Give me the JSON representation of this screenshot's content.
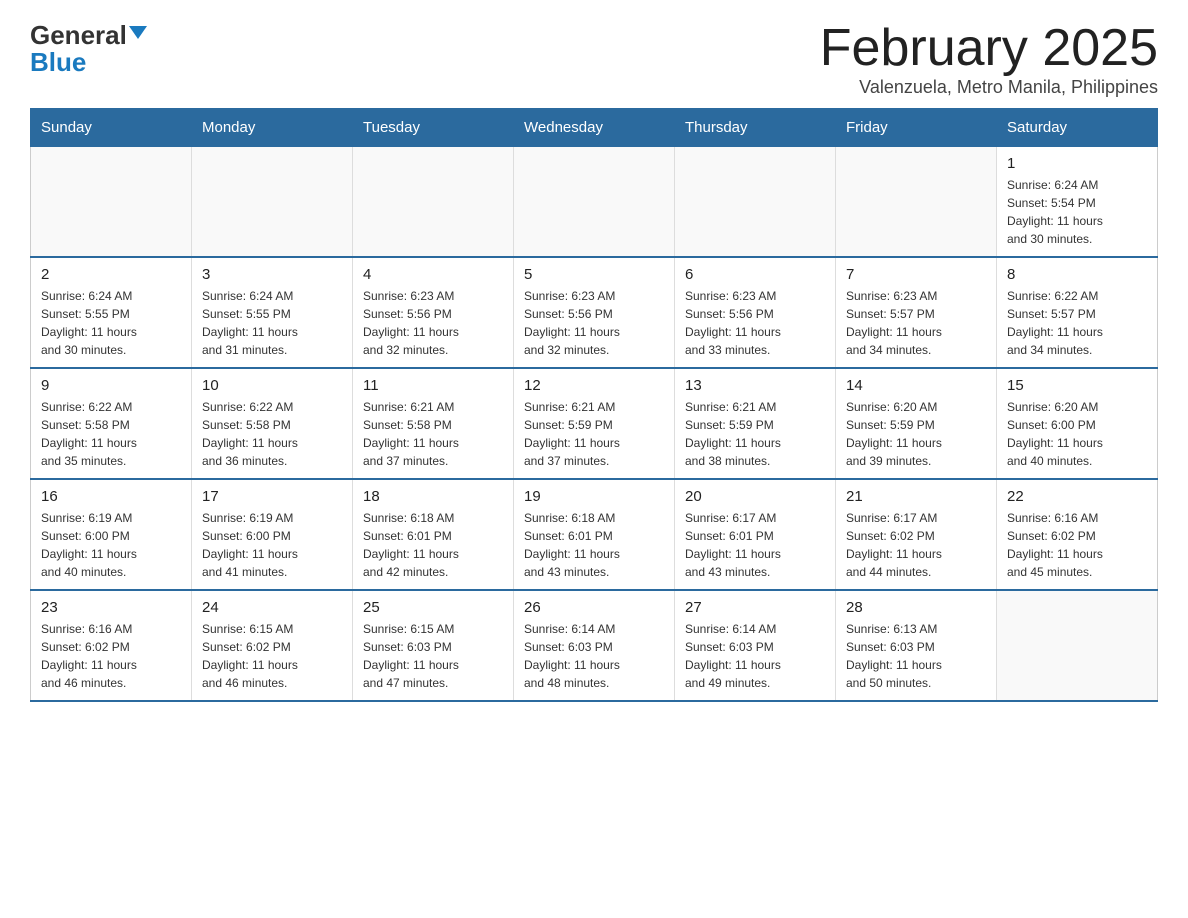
{
  "header": {
    "logo_general": "General",
    "logo_blue": "Blue",
    "title": "February 2025",
    "subtitle": "Valenzuela, Metro Manila, Philippines"
  },
  "days_of_week": [
    "Sunday",
    "Monday",
    "Tuesday",
    "Wednesday",
    "Thursday",
    "Friday",
    "Saturday"
  ],
  "weeks": [
    {
      "days": [
        {
          "number": "",
          "info": ""
        },
        {
          "number": "",
          "info": ""
        },
        {
          "number": "",
          "info": ""
        },
        {
          "number": "",
          "info": ""
        },
        {
          "number": "",
          "info": ""
        },
        {
          "number": "",
          "info": ""
        },
        {
          "number": "1",
          "info": "Sunrise: 6:24 AM\nSunset: 5:54 PM\nDaylight: 11 hours\nand 30 minutes."
        }
      ]
    },
    {
      "days": [
        {
          "number": "2",
          "info": "Sunrise: 6:24 AM\nSunset: 5:55 PM\nDaylight: 11 hours\nand 30 minutes."
        },
        {
          "number": "3",
          "info": "Sunrise: 6:24 AM\nSunset: 5:55 PM\nDaylight: 11 hours\nand 31 minutes."
        },
        {
          "number": "4",
          "info": "Sunrise: 6:23 AM\nSunset: 5:56 PM\nDaylight: 11 hours\nand 32 minutes."
        },
        {
          "number": "5",
          "info": "Sunrise: 6:23 AM\nSunset: 5:56 PM\nDaylight: 11 hours\nand 32 minutes."
        },
        {
          "number": "6",
          "info": "Sunrise: 6:23 AM\nSunset: 5:56 PM\nDaylight: 11 hours\nand 33 minutes."
        },
        {
          "number": "7",
          "info": "Sunrise: 6:23 AM\nSunset: 5:57 PM\nDaylight: 11 hours\nand 34 minutes."
        },
        {
          "number": "8",
          "info": "Sunrise: 6:22 AM\nSunset: 5:57 PM\nDaylight: 11 hours\nand 34 minutes."
        }
      ]
    },
    {
      "days": [
        {
          "number": "9",
          "info": "Sunrise: 6:22 AM\nSunset: 5:58 PM\nDaylight: 11 hours\nand 35 minutes."
        },
        {
          "number": "10",
          "info": "Sunrise: 6:22 AM\nSunset: 5:58 PM\nDaylight: 11 hours\nand 36 minutes."
        },
        {
          "number": "11",
          "info": "Sunrise: 6:21 AM\nSunset: 5:58 PM\nDaylight: 11 hours\nand 37 minutes."
        },
        {
          "number": "12",
          "info": "Sunrise: 6:21 AM\nSunset: 5:59 PM\nDaylight: 11 hours\nand 37 minutes."
        },
        {
          "number": "13",
          "info": "Sunrise: 6:21 AM\nSunset: 5:59 PM\nDaylight: 11 hours\nand 38 minutes."
        },
        {
          "number": "14",
          "info": "Sunrise: 6:20 AM\nSunset: 5:59 PM\nDaylight: 11 hours\nand 39 minutes."
        },
        {
          "number": "15",
          "info": "Sunrise: 6:20 AM\nSunset: 6:00 PM\nDaylight: 11 hours\nand 40 minutes."
        }
      ]
    },
    {
      "days": [
        {
          "number": "16",
          "info": "Sunrise: 6:19 AM\nSunset: 6:00 PM\nDaylight: 11 hours\nand 40 minutes."
        },
        {
          "number": "17",
          "info": "Sunrise: 6:19 AM\nSunset: 6:00 PM\nDaylight: 11 hours\nand 41 minutes."
        },
        {
          "number": "18",
          "info": "Sunrise: 6:18 AM\nSunset: 6:01 PM\nDaylight: 11 hours\nand 42 minutes."
        },
        {
          "number": "19",
          "info": "Sunrise: 6:18 AM\nSunset: 6:01 PM\nDaylight: 11 hours\nand 43 minutes."
        },
        {
          "number": "20",
          "info": "Sunrise: 6:17 AM\nSunset: 6:01 PM\nDaylight: 11 hours\nand 43 minutes."
        },
        {
          "number": "21",
          "info": "Sunrise: 6:17 AM\nSunset: 6:02 PM\nDaylight: 11 hours\nand 44 minutes."
        },
        {
          "number": "22",
          "info": "Sunrise: 6:16 AM\nSunset: 6:02 PM\nDaylight: 11 hours\nand 45 minutes."
        }
      ]
    },
    {
      "days": [
        {
          "number": "23",
          "info": "Sunrise: 6:16 AM\nSunset: 6:02 PM\nDaylight: 11 hours\nand 46 minutes."
        },
        {
          "number": "24",
          "info": "Sunrise: 6:15 AM\nSunset: 6:02 PM\nDaylight: 11 hours\nand 46 minutes."
        },
        {
          "number": "25",
          "info": "Sunrise: 6:15 AM\nSunset: 6:03 PM\nDaylight: 11 hours\nand 47 minutes."
        },
        {
          "number": "26",
          "info": "Sunrise: 6:14 AM\nSunset: 6:03 PM\nDaylight: 11 hours\nand 48 minutes."
        },
        {
          "number": "27",
          "info": "Sunrise: 6:14 AM\nSunset: 6:03 PM\nDaylight: 11 hours\nand 49 minutes."
        },
        {
          "number": "28",
          "info": "Sunrise: 6:13 AM\nSunset: 6:03 PM\nDaylight: 11 hours\nand 50 minutes."
        },
        {
          "number": "",
          "info": ""
        }
      ]
    }
  ]
}
